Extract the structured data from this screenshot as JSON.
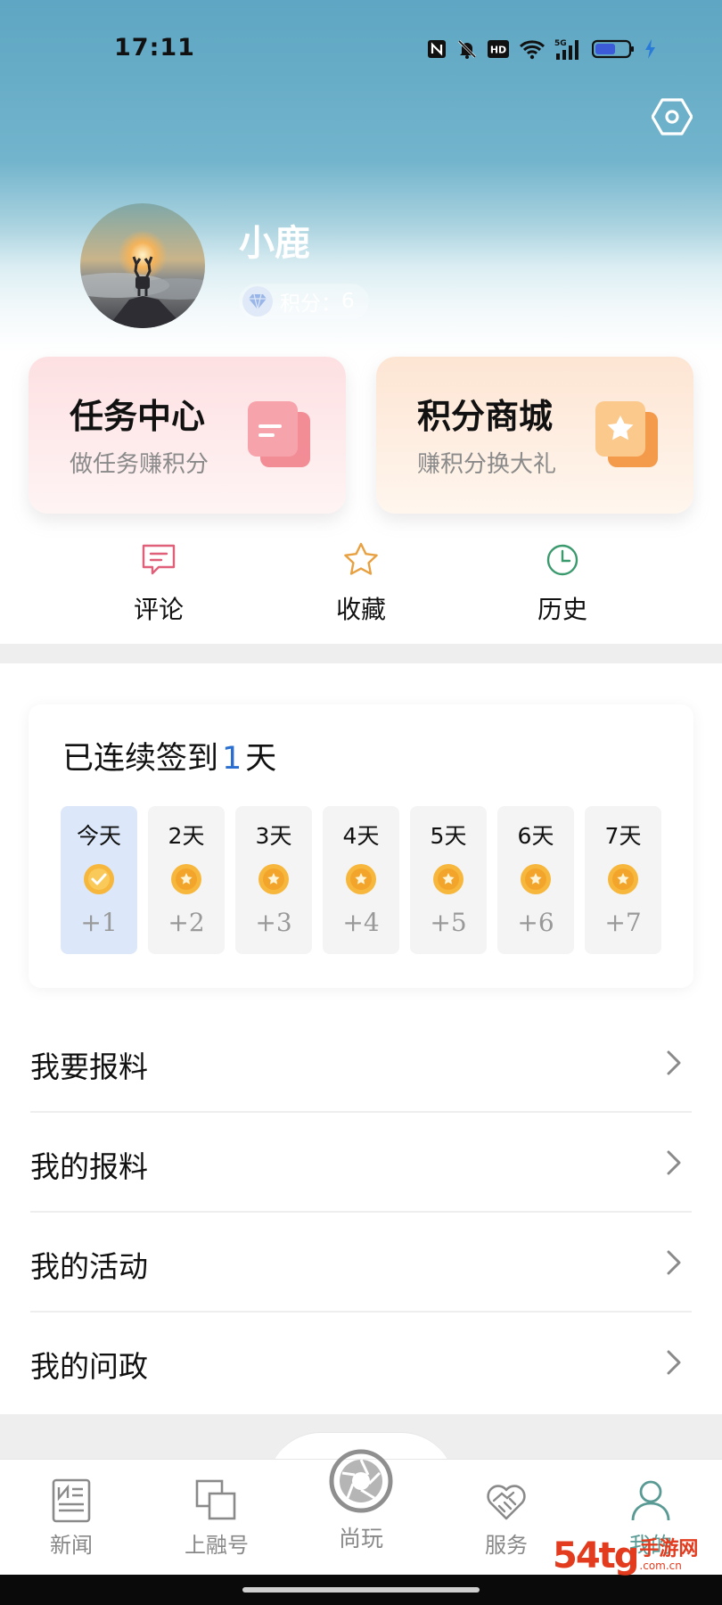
{
  "status_bar": {
    "time": "17:11",
    "icons": [
      "nfc-icon",
      "mute-icon",
      "hd-icon",
      "wifi-icon",
      "5g-signal-icon",
      "battery-icon",
      "charging-icon"
    ]
  },
  "header": {
    "settings_icon": "hexagon-settings-icon",
    "username": "小鹿",
    "points_label": "积分：",
    "points_value": "6"
  },
  "cards": [
    {
      "title": "任务中心",
      "subtitle": "做任务赚积分",
      "icon": "task-card-icon",
      "accent": "#f0707c"
    },
    {
      "title": "积分商城",
      "subtitle": "赚积分换大礼",
      "icon": "star-card-icon",
      "accent": "#f39a4b"
    }
  ],
  "quick_actions": [
    {
      "label": "评论",
      "icon": "comment-icon",
      "color": "#e0607a"
    },
    {
      "label": "收藏",
      "icon": "star-icon",
      "color": "#e8a040"
    },
    {
      "label": "历史",
      "icon": "clock-icon",
      "color": "#3a9a6e"
    }
  ],
  "checkin": {
    "prefix": "已连续签到",
    "days": "1",
    "suffix": "天",
    "items": [
      {
        "label": "今天",
        "bonus": "+1",
        "state": "checked"
      },
      {
        "label": "2天",
        "bonus": "+2",
        "state": "pending"
      },
      {
        "label": "3天",
        "bonus": "+3",
        "state": "pending"
      },
      {
        "label": "4天",
        "bonus": "+4",
        "state": "pending"
      },
      {
        "label": "5天",
        "bonus": "+5",
        "state": "pending"
      },
      {
        "label": "6天",
        "bonus": "+6",
        "state": "pending"
      },
      {
        "label": "7天",
        "bonus": "+7",
        "state": "pending"
      }
    ]
  },
  "menu": [
    {
      "label": "我要报料"
    },
    {
      "label": "我的报料"
    },
    {
      "label": "我的活动"
    },
    {
      "label": "我的问政"
    }
  ],
  "tabbar": [
    {
      "label": "新闻",
      "icon": "news-icon",
      "active": false
    },
    {
      "label": "上融号",
      "icon": "squares-icon",
      "active": false
    },
    {
      "label": "尚玩",
      "icon": "aperture-icon",
      "active": false
    },
    {
      "label": "服务",
      "icon": "handshake-icon",
      "active": false
    },
    {
      "label": "我的",
      "icon": "person-icon",
      "active": true
    }
  ],
  "watermark": {
    "number": "54tg",
    "text": "手游网",
    "domain": ".com.cn"
  }
}
